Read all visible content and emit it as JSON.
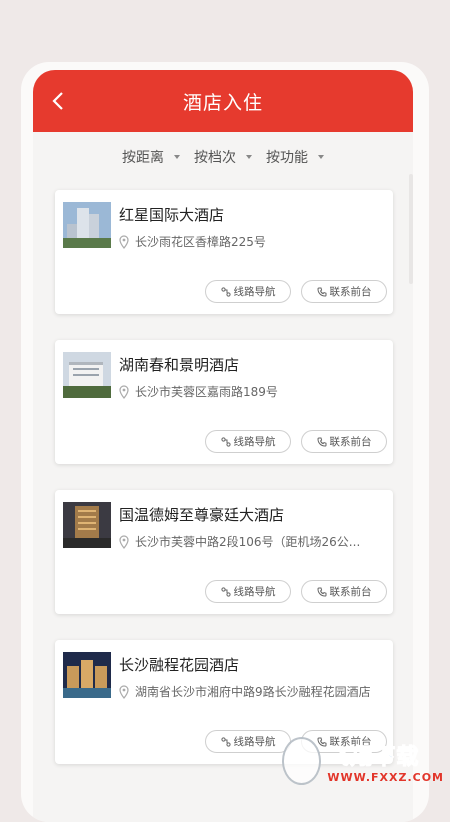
{
  "header": {
    "title": "酒店入住",
    "back_icon": "chevron-left-icon"
  },
  "filters": [
    {
      "label": "按距离"
    },
    {
      "label": "按档次"
    },
    {
      "label": "按功能"
    }
  ],
  "buttons": {
    "navigate": "线路导航",
    "call": "联系前台"
  },
  "hotels": [
    {
      "name": "红星国际大酒店",
      "address": "长沙雨花区香樟路225号"
    },
    {
      "name": "湖南春和景明酒店",
      "address": "长沙市芙蓉区嘉雨路189号"
    },
    {
      "name": "国温德姆至尊豪廷大酒店",
      "address": "长沙市芙蓉中路2段106号（距机场26公..."
    },
    {
      "name": "长沙融程花园酒店",
      "address": "湖南省长沙市湘府中路9路长沙融程花园酒店"
    }
  ],
  "watermark": {
    "title": "飞翔下载",
    "url": "WWW.FXXZ.COM"
  },
  "colors": {
    "primary": "#e63a2e",
    "background": "#efe9e8"
  }
}
